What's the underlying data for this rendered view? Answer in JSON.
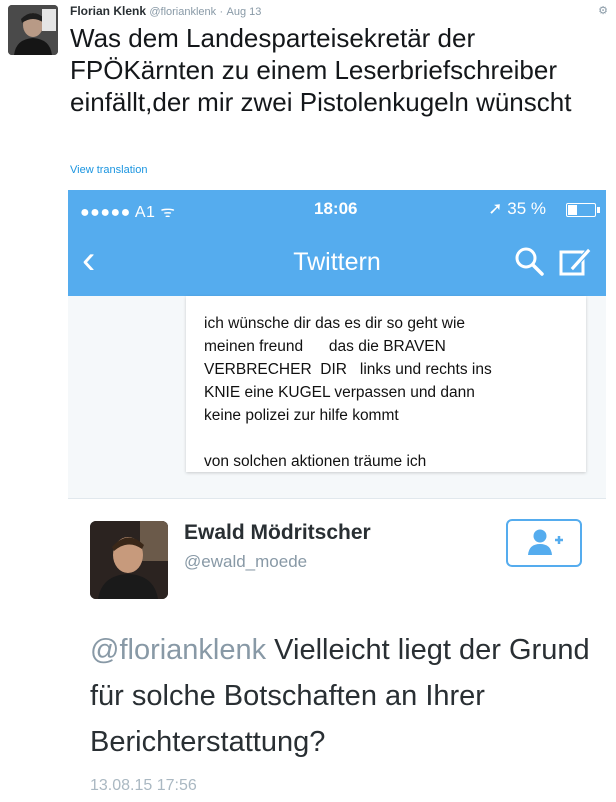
{
  "tweet": {
    "author_name": "Florian Klenk",
    "author_handle": "@florianklenk",
    "separator": "·",
    "date": "Aug 13",
    "text": "Was dem Landesparteisekretär der FPÖKärnten zu einem Leserbriefschreiber einfällt,der mir zwei Pistolenkugeln wünscht",
    "view_translation": "View translation",
    "avatar_icon": "user-avatar-icon",
    "menu_icon": "gear-icon"
  },
  "screenshot": {
    "status_bar": {
      "carrier": "●●●●● A1",
      "time": "18:06",
      "battery": "35 %"
    },
    "nav": {
      "title": "Twittern",
      "back_icon": "chevron-left-icon",
      "search_icon": "search-icon",
      "compose_icon": "compose-icon"
    },
    "letter_text": "ich wünsche dir das es dir so geht wie\nmeinen freund      das die BRAVEN\nVERBRECHER  DIR   links und rechts ins\nKNIE eine KUGEL verpassen und dann\nkeine polizei zur hilfe kommt\n\nvon solchen aktionen träume ich",
    "inner_tweet": {
      "name": "Ewald Mödritscher",
      "handle": "@ewald_moede",
      "mention": "@florianklenk",
      "text": " Vielleicht liegt der Grund für solche Botschaften an Ihrer Berichterstattung?",
      "timestamp": "13.08.15 17:56",
      "follow_icon": "add-user-icon"
    }
  },
  "colors": {
    "twitter_blue": "#55acee",
    "link": "#1b95e0",
    "muted": "#8899a6"
  }
}
